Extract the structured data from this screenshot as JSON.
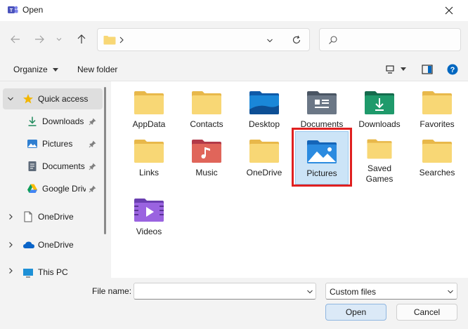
{
  "window": {
    "title": "Open",
    "app_icon": "teams-icon"
  },
  "nav": {
    "address_path": ""
  },
  "toolbar": {
    "organize_label": "Organize",
    "new_folder_label": "New folder"
  },
  "sidebar": {
    "items": [
      {
        "label": "Quick access",
        "icon": "star-icon",
        "active": true
      },
      {
        "label": "Downloads",
        "icon": "download-icon",
        "pinned": true
      },
      {
        "label": "Pictures",
        "icon": "pictures-icon",
        "pinned": true
      },
      {
        "label": "Documents",
        "icon": "documents-icon",
        "pinned": true
      },
      {
        "label": "Google Drive",
        "icon": "google-drive-icon",
        "pinned": true
      },
      {
        "label": "OneDrive",
        "icon": "file-icon"
      },
      {
        "label": "OneDrive",
        "icon": "cloud-icon"
      },
      {
        "label": "This PC",
        "icon": "pc-icon"
      }
    ]
  },
  "folders": [
    {
      "label": "AppData",
      "type": "plain"
    },
    {
      "label": "Contacts",
      "type": "plain"
    },
    {
      "label": "Desktop",
      "type": "desktop"
    },
    {
      "label": "Documents",
      "type": "documents"
    },
    {
      "label": "Downloads",
      "type": "downloads"
    },
    {
      "label": "Favorites",
      "type": "plain"
    },
    {
      "label": "Links",
      "type": "plain"
    },
    {
      "label": "Music",
      "type": "music"
    },
    {
      "label": "OneDrive",
      "type": "plain"
    },
    {
      "label": "Pictures",
      "type": "pictures",
      "selected": true
    },
    {
      "label": "Saved Games",
      "type": "plain"
    },
    {
      "label": "Searches",
      "type": "plain"
    },
    {
      "label": "Videos",
      "type": "videos"
    }
  ],
  "footer": {
    "file_name_label": "File name:",
    "file_name_value": "",
    "filter_value": "Custom files",
    "open_label": "Open",
    "cancel_label": "Cancel"
  },
  "colors": {
    "folder_yellow": "#f8d775",
    "selection": "#cce4f7",
    "highlight": "#e02020",
    "accent": "#0067c0"
  }
}
